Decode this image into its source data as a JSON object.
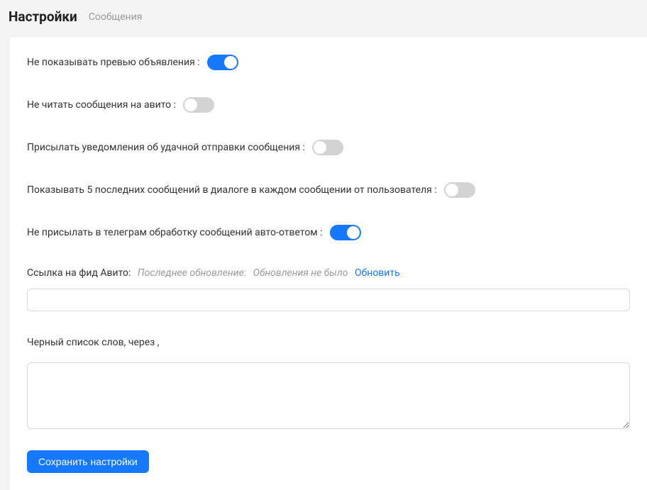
{
  "header": {
    "title": "Настройки",
    "subtitle": "Сообщения"
  },
  "settings": [
    {
      "label": "Не показывать превью объявления :",
      "on": true
    },
    {
      "label": "Не читать сообщения на авито :",
      "on": false
    },
    {
      "label": "Присылать уведомления об удачной отправки сообщения :",
      "on": false
    },
    {
      "label": "Показывать 5 последних сообщений в диалоге в каждом сообщении от пользователя :",
      "on": false
    },
    {
      "label": "Не присылать в телеграм обработку сообщений авто-ответом :",
      "on": true
    }
  ],
  "feed": {
    "label": "Ссылка на фид Авито:",
    "last_update_prefix": "Последнее обновление:",
    "last_update_value": "Обновления не было",
    "refresh": "Обновить",
    "value": ""
  },
  "blacklist": {
    "label": "Черный список слов, через ,",
    "value": ""
  },
  "save_label": "Сохранить настройки"
}
